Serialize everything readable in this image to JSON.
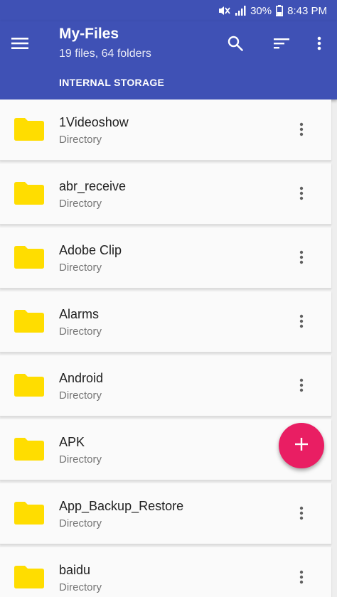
{
  "status_bar": {
    "battery": "30%",
    "time": "8:43 PM",
    "icons": [
      "mute-icon",
      "signal-icon",
      "battery-icon"
    ]
  },
  "app_bar": {
    "title": "My-Files",
    "subtitle": "19 files, 64 folders",
    "tab_label": "INTERNAL STORAGE",
    "actions": [
      "menu-icon",
      "search-icon",
      "sort-icon",
      "more-vert-icon"
    ]
  },
  "files": [
    {
      "name": "1Videoshow",
      "type": "Directory"
    },
    {
      "name": "abr_receive",
      "type": "Directory"
    },
    {
      "name": "Adobe Clip",
      "type": "Directory"
    },
    {
      "name": "Alarms",
      "type": "Directory"
    },
    {
      "name": "Android",
      "type": "Directory"
    },
    {
      "name": "APK",
      "type": "Directory"
    },
    {
      "name": "App_Backup_Restore",
      "type": "Directory"
    },
    {
      "name": "baidu",
      "type": "Directory"
    }
  ],
  "fab": {
    "icon": "plus-icon"
  },
  "colors": {
    "primary": "#3f51b5",
    "accent": "#e91e63",
    "folder": "#ffdd00"
  }
}
